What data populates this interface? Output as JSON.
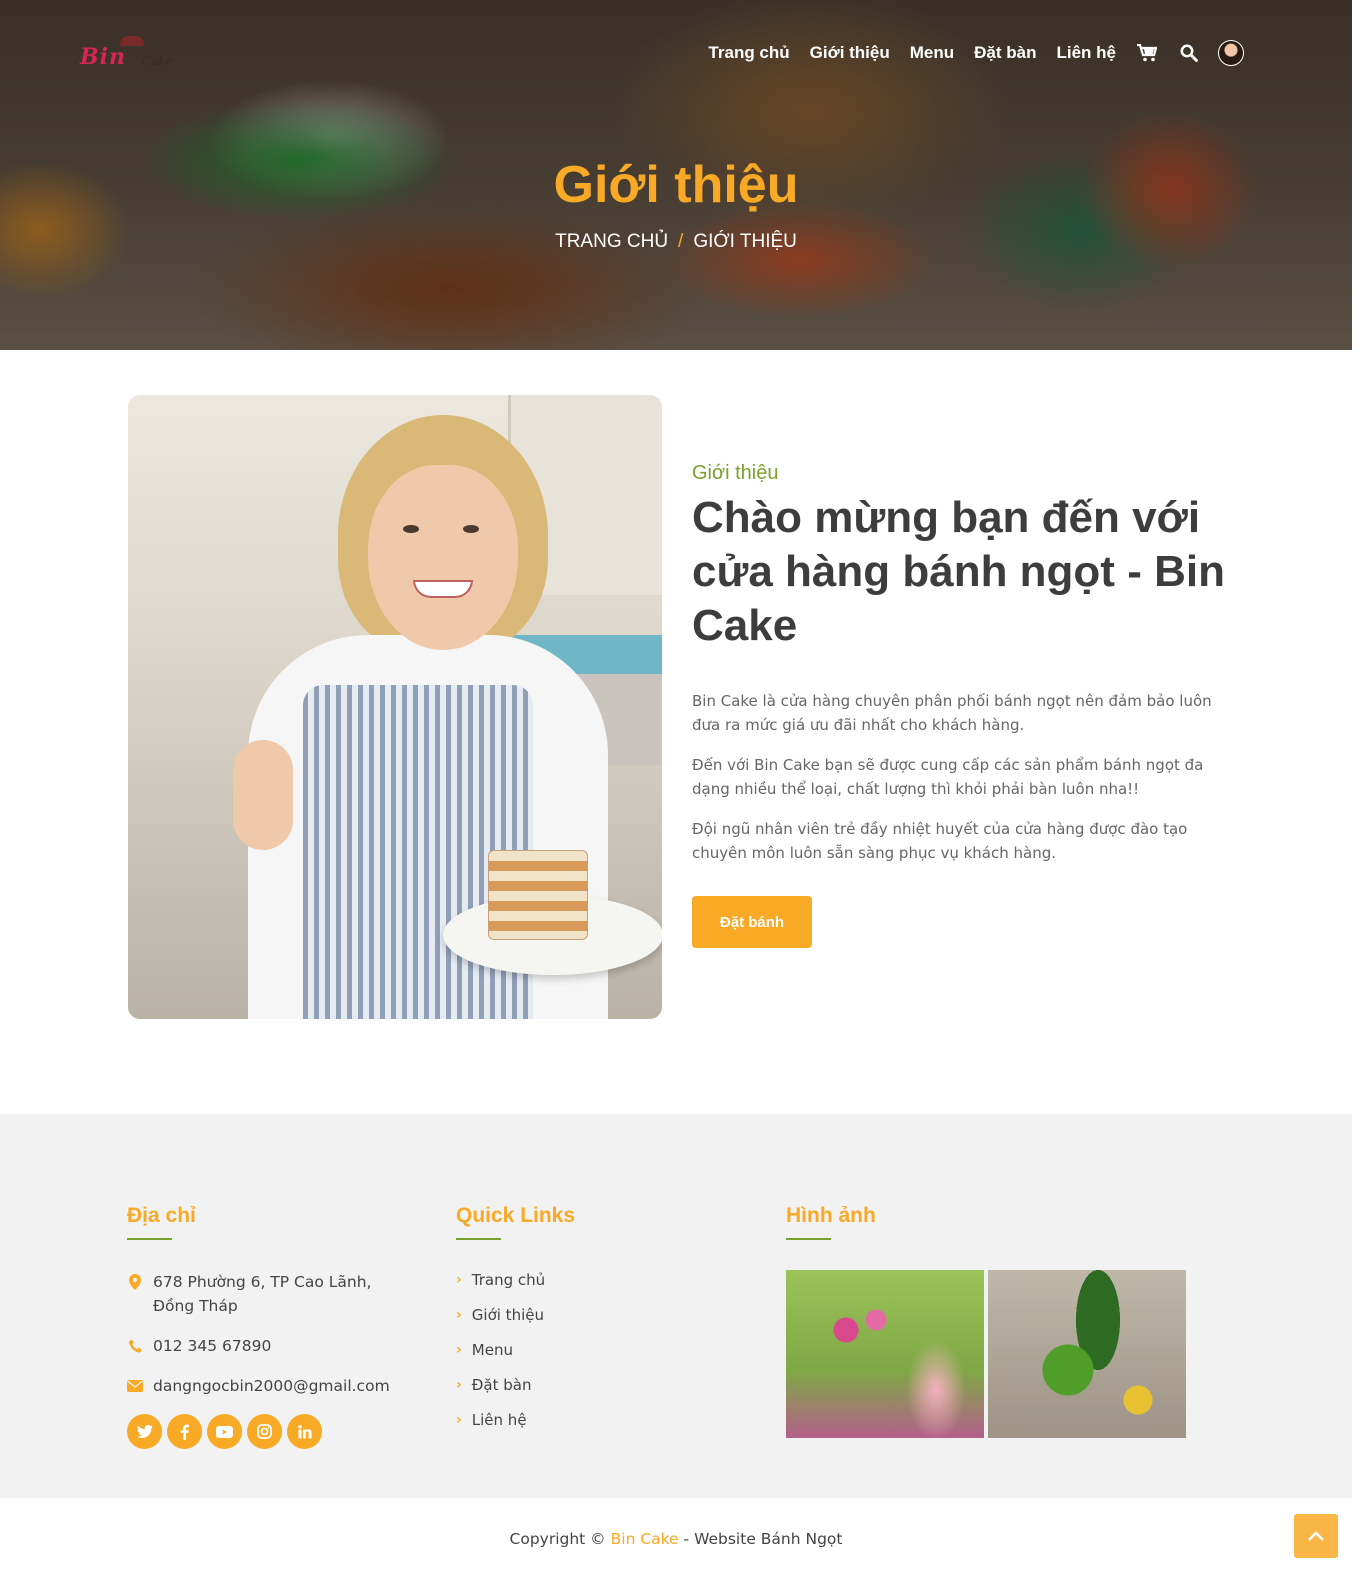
{
  "header": {
    "logo_text": "Bin",
    "logo_sub": "Cake",
    "nav": [
      "Trang chủ",
      "Giới thiệu",
      "Menu",
      "Đặt bàn",
      "Liên hệ"
    ],
    "icons": [
      "cart-icon",
      "search-icon",
      "avatar"
    ]
  },
  "hero": {
    "title": "Giới thiệu",
    "breadcrumb_home": "TRANG CHỦ",
    "breadcrumb_sep": "/",
    "breadcrumb_current": "GIỚI THIỆU"
  },
  "about": {
    "kicker": "Giới thiệu",
    "heading": "Chào mừng bạn đến với cửa hàng bánh ngọt - Bin Cake",
    "paragraphs": [
      "Bin Cake là cửa hàng chuyên phân phối bánh ngọt nên đảm bảo luôn đưa ra mức giá ưu đãi nhất cho khách hàng.",
      "Đến với Bin Cake bạn sẽ được cung cấp các sản phẩm bánh ngọt đa dạng nhiều thể loại, chất lượng thì khỏi phải bàn luôn nha!!",
      "Đội ngũ nhân viên trẻ đầy nhiệt huyết của cửa hàng được đào tạo chuyên môn luôn sẵn sàng phục vụ khách hàng."
    ],
    "button": "Đặt bánh"
  },
  "footer": {
    "address": {
      "title": "Địa chỉ",
      "location": "678 Phường 6, TP Cao Lãnh, Đồng Tháp",
      "phone": "012 345 67890",
      "email": "dangngocbin2000@gmail.com",
      "socials": [
        "twitter-icon",
        "facebook-icon",
        "youtube-icon",
        "instagram-icon",
        "linkedin-icon"
      ]
    },
    "quick_links": {
      "title": "Quick Links",
      "items": [
        "Trang chủ",
        "Giới thiệu",
        "Menu",
        "Đặt bàn",
        "Liên hệ"
      ]
    },
    "gallery": {
      "title": "Hình ảnh"
    }
  },
  "copyright": {
    "prefix": "Copyright ©",
    "brand": "Bin Cake",
    "suffix": "- Website Bánh Ngọt"
  },
  "colors": {
    "accent": "#f8a925",
    "green": "#7aa12a",
    "text": "#444444",
    "footer_bg": "#f2f2f2"
  }
}
